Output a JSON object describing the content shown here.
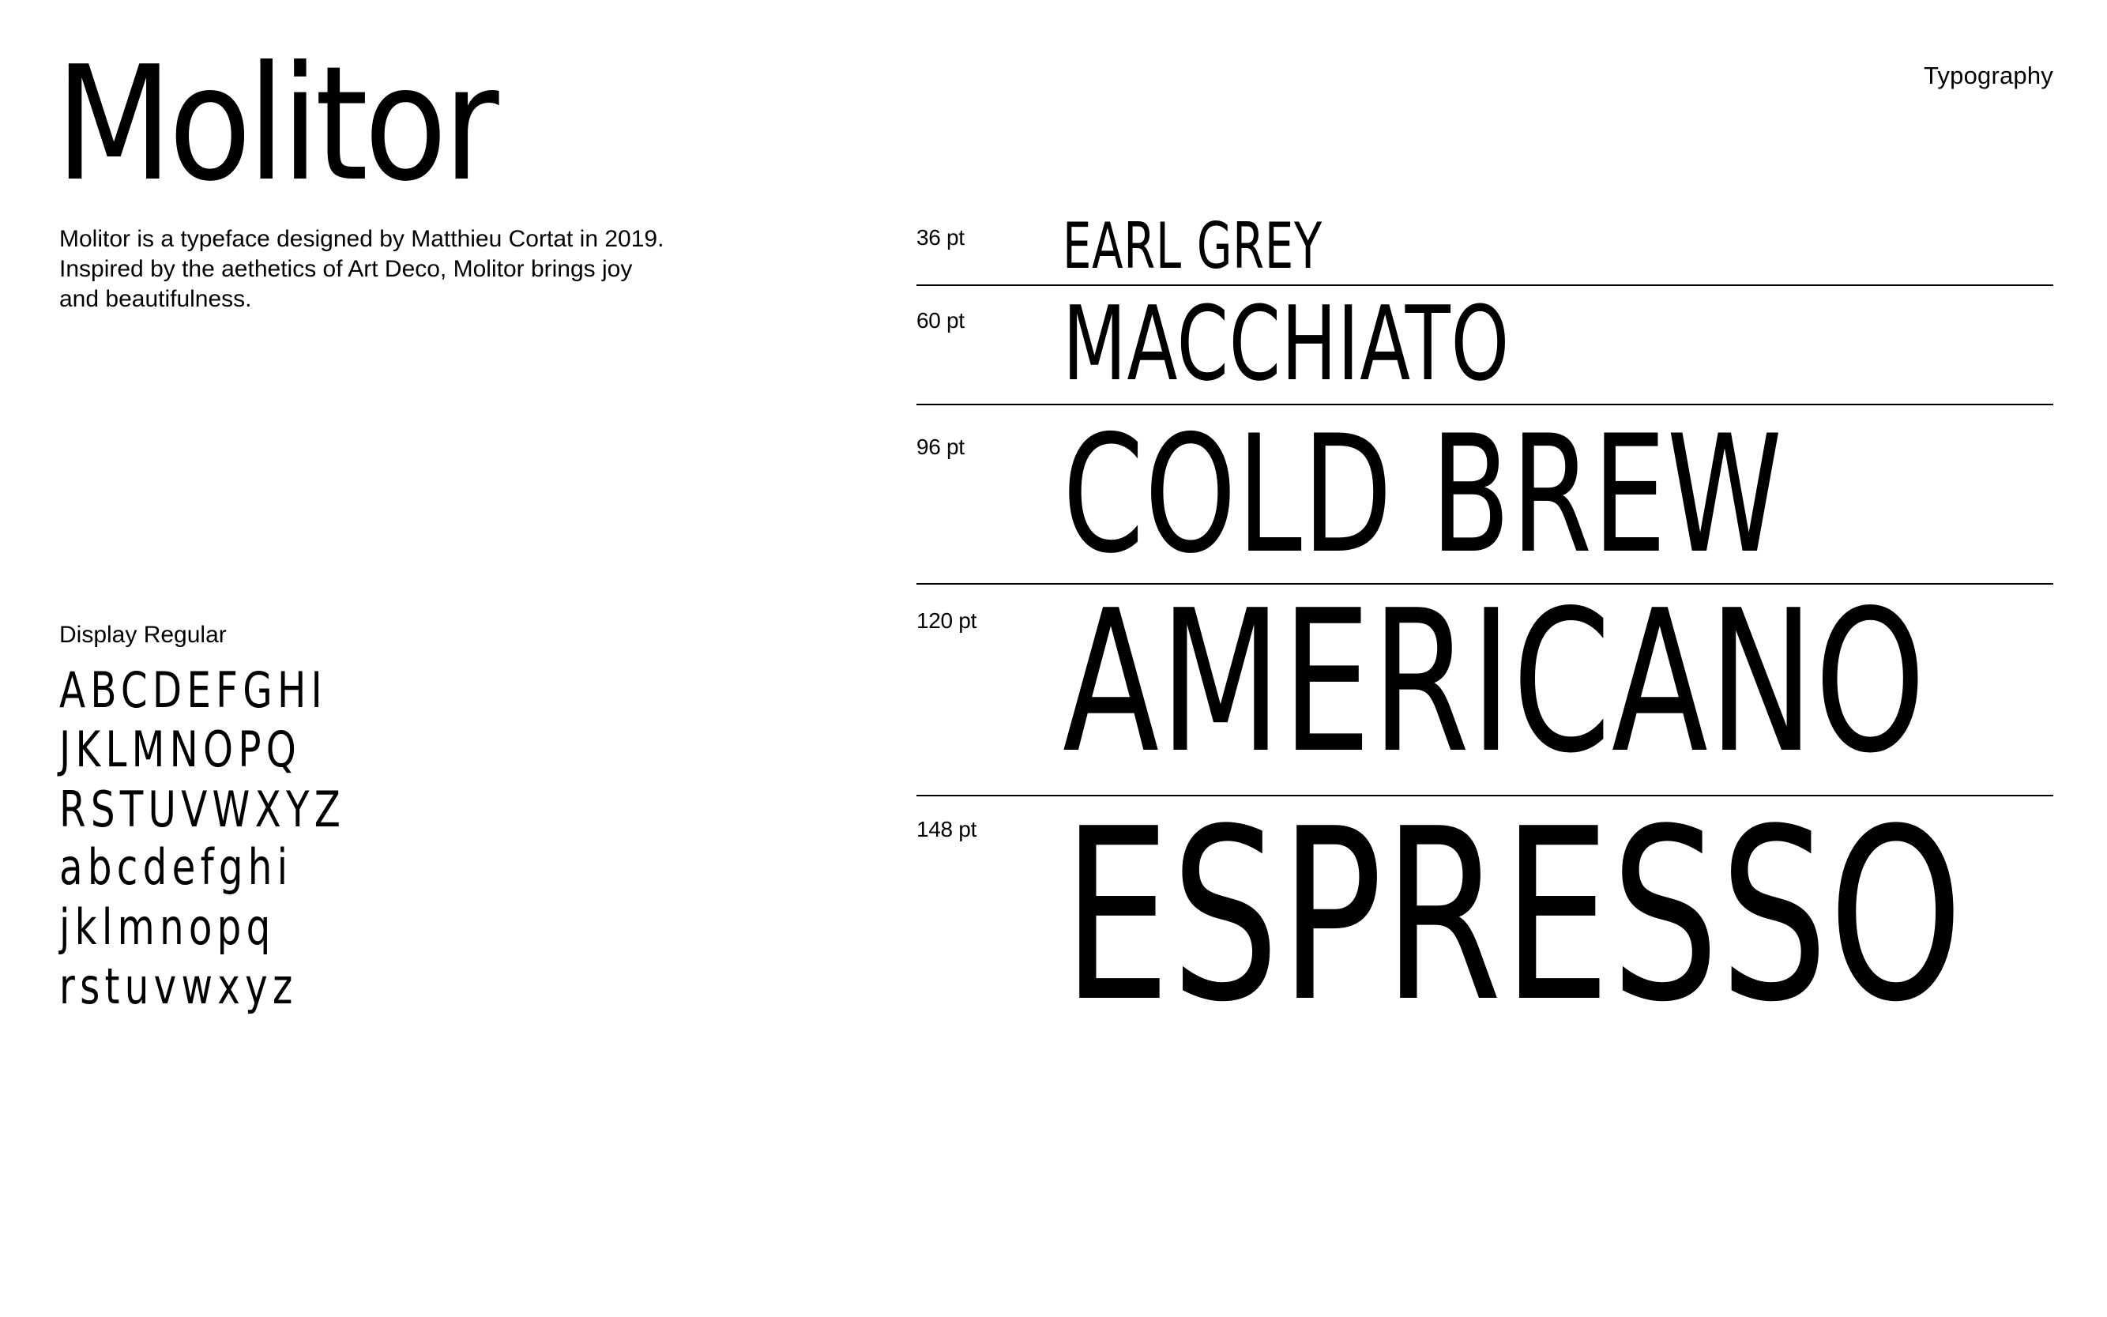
{
  "header": {
    "title": "Molitor",
    "section": "Typography"
  },
  "intro": {
    "lines": [
      "Molitor is a typeface designed by Matthieu Cortat in 2019.",
      "Inspired by the aethetics of Art Deco, Molitor brings joy",
      "and beautifulness."
    ]
  },
  "glyphs": {
    "heading": "Display Regular",
    "lines": [
      "ABCDEFGHI",
      "JKLMNOPQ",
      "RSTUVWXYZ",
      "abcdefghi",
      "jklmnopq",
      "rstuvwxyz"
    ]
  },
  "specimens": [
    {
      "size_label": "36 pt",
      "sample": "EARL GREY"
    },
    {
      "size_label": "60 pt",
      "sample": "MACCHIATO"
    },
    {
      "size_label": "96 pt",
      "sample": "COLD BREW"
    },
    {
      "size_label": "120 pt",
      "sample": "AMERICANO"
    },
    {
      "size_label": "148 pt",
      "sample": "ESPRESSO"
    }
  ],
  "colors": {
    "background": "#ffffff",
    "text": "#000000"
  }
}
